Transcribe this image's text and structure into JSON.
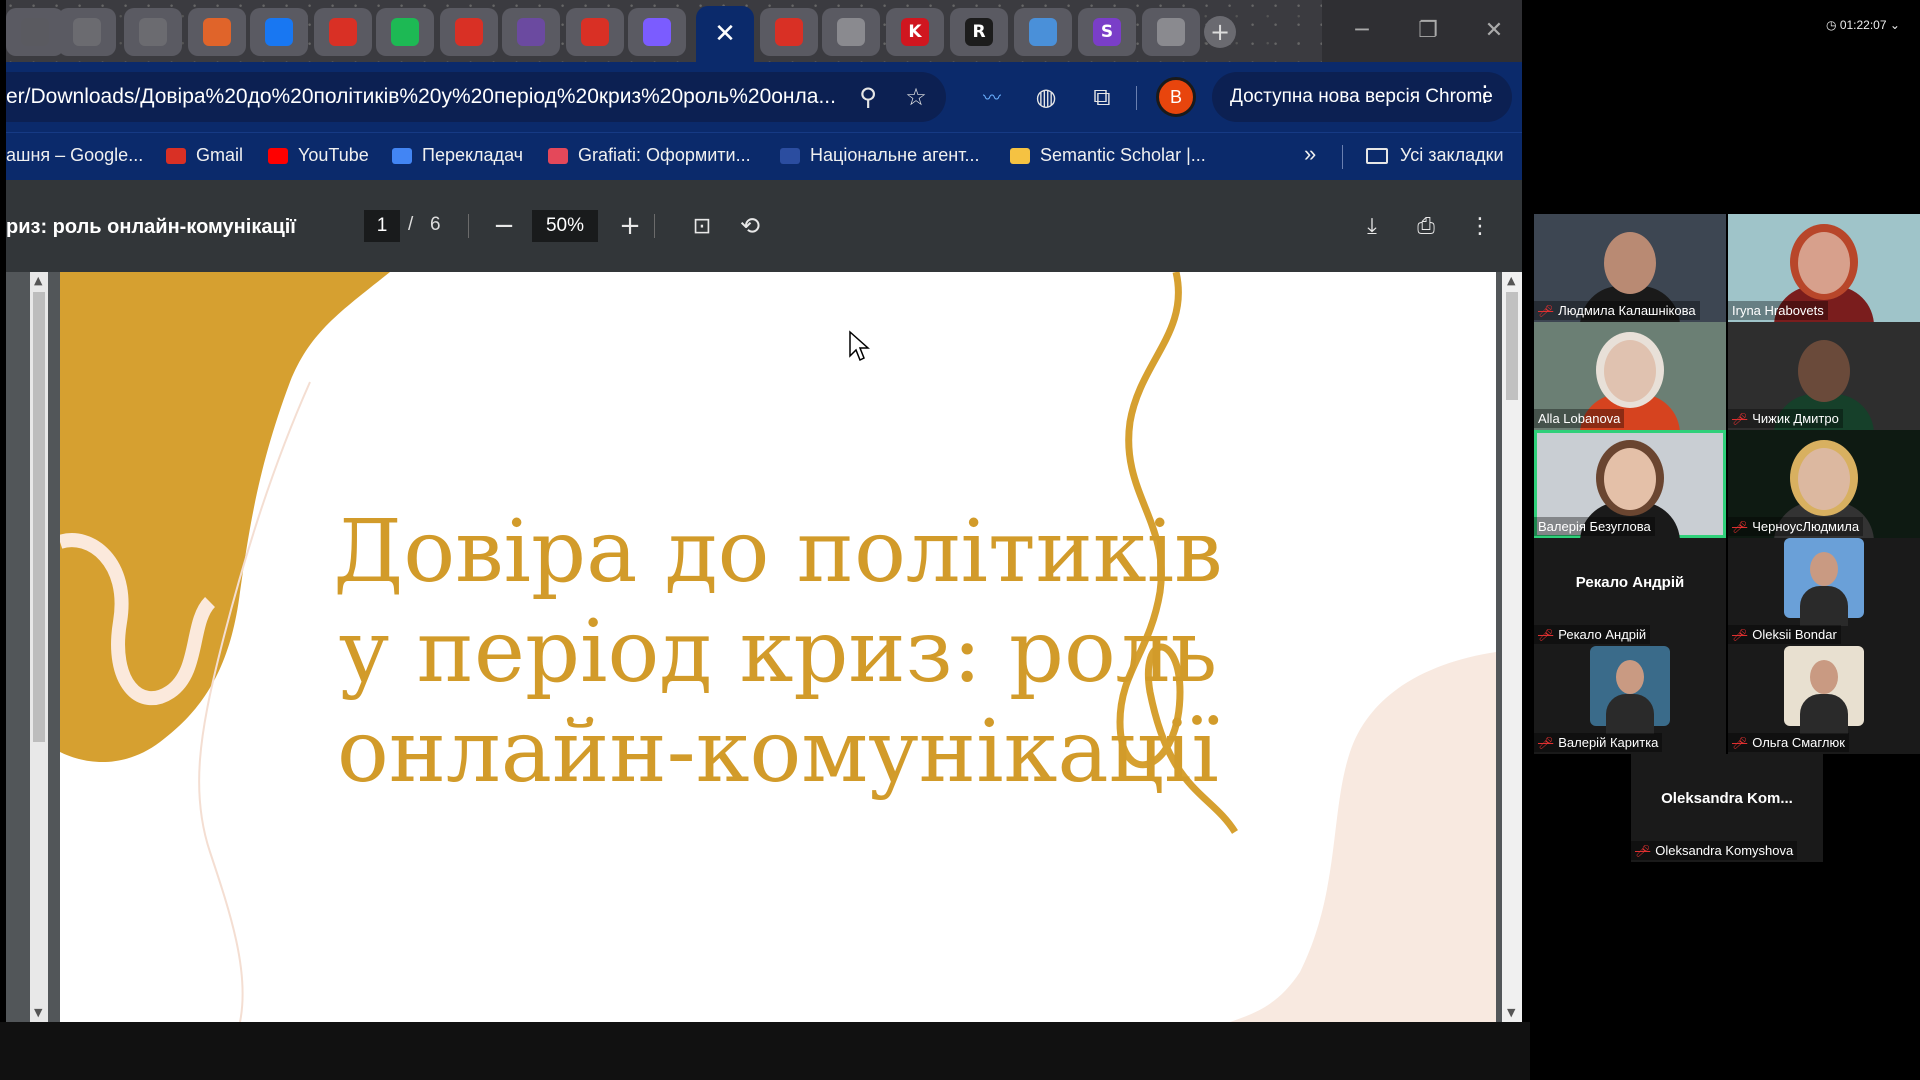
{
  "browser": {
    "tabs": [
      {
        "icon": "generic-favicon-icon",
        "color": "#5a5a60"
      },
      {
        "icon": "library-icon",
        "color": "#6b6b70"
      },
      {
        "icon": "library-icon",
        "color": "#6b6b70"
      },
      {
        "icon": "prometheus-icon",
        "color": "#e0642a"
      },
      {
        "icon": "facebook-icon",
        "color": "#1877f2"
      },
      {
        "icon": "gmail-icon",
        "color": "#d93025"
      },
      {
        "icon": "green-circle-icon",
        "color": "#1db954"
      },
      {
        "icon": "gmail-icon",
        "color": "#d93025"
      },
      {
        "icon": "shield-icon",
        "color": "#6b4aa0"
      },
      {
        "icon": "gmail-icon",
        "color": "#d93025"
      },
      {
        "icon": "chat-icon",
        "color": "#7b5cff"
      },
      {
        "icon": "active-tab",
        "color": "#0b2a6b",
        "close": "✕"
      },
      {
        "icon": "gmail-icon",
        "color": "#d93025"
      },
      {
        "icon": "chrome-icon",
        "color": "#8a8a8f"
      },
      {
        "icon": "k-icon",
        "color": "#d0161f",
        "letter": "K"
      },
      {
        "icon": "r-icon",
        "color": "#1c1c1c",
        "letter": "R"
      },
      {
        "icon": "snowflake-icon",
        "color": "#4a90d9"
      },
      {
        "icon": "s-icon",
        "color": "#7a3ec8",
        "letter": "S"
      },
      {
        "icon": "chrome-icon",
        "color": "#8a8a8f"
      }
    ],
    "new_tab": "+",
    "url": "er/Downloads/Довіра%20до%20політиків%20у%20період%20криз%20роль%20онла...",
    "update_label": "Доступна нова версія Chrome",
    "profile_initial": "B",
    "bookmarks": [
      {
        "label": "ашня – Google...",
        "icon": "google-icon",
        "color": "#0b2a6b"
      },
      {
        "label": "Gmail",
        "icon": "gmail-icon",
        "color": "#d93025"
      },
      {
        "label": "YouTube",
        "icon": "youtube-icon",
        "color": "#ff0000"
      },
      {
        "label": "Перекладач",
        "icon": "translate-icon",
        "color": "#4285f4"
      },
      {
        "label": "Grafiati: Оформити...",
        "icon": "grafiati-icon",
        "color": "#e4485a"
      },
      {
        "label": "Національне агент...",
        "icon": "trident-icon",
        "color": "#2b4da0"
      },
      {
        "label": "Semantic Scholar |...",
        "icon": "semantic-scholar-icon",
        "color": "#f5c242"
      }
    ],
    "bookmarks_overflow": "»",
    "all_bookmarks": "Усі закладки"
  },
  "pdf": {
    "title": "риз: роль онлайн-комунікації",
    "page_current": "1",
    "page_separator": "/",
    "page_total": "6",
    "zoom": "50%",
    "slide_title_lines": [
      "Довіра до політиків",
      "у період криз: роль",
      "онлайн-комунікації"
    ],
    "accent_color": "#d29b2a"
  },
  "meeting": {
    "timer": "01:22:07",
    "participants": [
      {
        "name": "Людмила Калашнікова",
        "muted": true,
        "video": true,
        "bg": "#3d4652",
        "shirt": "#1a1a1a",
        "skin": "#b98a73"
      },
      {
        "name": "Iryna Hrabovets",
        "muted": false,
        "video": true,
        "bg": "#9fc4c9",
        "shirt": "#7a1d1d",
        "skin": "#d7a08c",
        "hair": "#b8462a"
      },
      {
        "name": "Alla Lobanova",
        "muted": false,
        "video": true,
        "bg": "#6b7f74",
        "shirt": "#d6431f",
        "skin": "#e0c2b0",
        "hair": "#e8e0d8"
      },
      {
        "name": "Чижик Дмитро",
        "muted": true,
        "video": true,
        "bg": "#2e2e2e",
        "shirt": "#16402a",
        "skin": "#6a4a3a"
      },
      {
        "name": "Валерія Безуглова",
        "muted": false,
        "video": true,
        "speaking": true,
        "bg": "#c9ced3",
        "shirt": "#1a1a1a",
        "skin": "#e4c0a8",
        "hair": "#6a4530"
      },
      {
        "name": "ЧерноусЛюдмила",
        "muted": true,
        "video": true,
        "bg": "#0e1a12",
        "shirt": "#333",
        "skin": "#dcb8a0",
        "hair": "#d8b060"
      },
      {
        "name": "Рекало Андрій",
        "muted": true,
        "video": false
      },
      {
        "name": "Oleksii Bondar",
        "muted": true,
        "video": false,
        "avatar": true,
        "avatar_bg": "#6aa0d8"
      },
      {
        "name": "Валерій Каритка",
        "muted": true,
        "video": false,
        "avatar": true,
        "avatar_bg": "#3a6b8a"
      },
      {
        "name": "Ольга Смаглюк",
        "muted": true,
        "video": false,
        "avatar": true,
        "avatar_bg": "#e8e0d0"
      },
      {
        "name": "Oleksandra Komyshova",
        "display_short": "Oleksandra  Kom...",
        "muted": true,
        "video": false
      }
    ]
  }
}
